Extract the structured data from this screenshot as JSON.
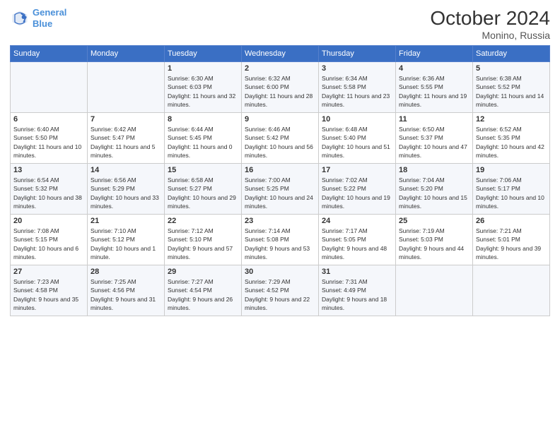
{
  "logo": {
    "line1": "General",
    "line2": "Blue"
  },
  "title": {
    "month": "October 2024",
    "location": "Monino, Russia"
  },
  "weekdays": [
    "Sunday",
    "Monday",
    "Tuesday",
    "Wednesday",
    "Thursday",
    "Friday",
    "Saturday"
  ],
  "weeks": [
    [
      {
        "day": "",
        "sunrise": "",
        "sunset": "",
        "daylight": ""
      },
      {
        "day": "",
        "sunrise": "",
        "sunset": "",
        "daylight": ""
      },
      {
        "day": "1",
        "sunrise": "Sunrise: 6:30 AM",
        "sunset": "Sunset: 6:03 PM",
        "daylight": "Daylight: 11 hours and 32 minutes."
      },
      {
        "day": "2",
        "sunrise": "Sunrise: 6:32 AM",
        "sunset": "Sunset: 6:00 PM",
        "daylight": "Daylight: 11 hours and 28 minutes."
      },
      {
        "day": "3",
        "sunrise": "Sunrise: 6:34 AM",
        "sunset": "Sunset: 5:58 PM",
        "daylight": "Daylight: 11 hours and 23 minutes."
      },
      {
        "day": "4",
        "sunrise": "Sunrise: 6:36 AM",
        "sunset": "Sunset: 5:55 PM",
        "daylight": "Daylight: 11 hours and 19 minutes."
      },
      {
        "day": "5",
        "sunrise": "Sunrise: 6:38 AM",
        "sunset": "Sunset: 5:52 PM",
        "daylight": "Daylight: 11 hours and 14 minutes."
      }
    ],
    [
      {
        "day": "6",
        "sunrise": "Sunrise: 6:40 AM",
        "sunset": "Sunset: 5:50 PM",
        "daylight": "Daylight: 11 hours and 10 minutes."
      },
      {
        "day": "7",
        "sunrise": "Sunrise: 6:42 AM",
        "sunset": "Sunset: 5:47 PM",
        "daylight": "Daylight: 11 hours and 5 minutes."
      },
      {
        "day": "8",
        "sunrise": "Sunrise: 6:44 AM",
        "sunset": "Sunset: 5:45 PM",
        "daylight": "Daylight: 11 hours and 0 minutes."
      },
      {
        "day": "9",
        "sunrise": "Sunrise: 6:46 AM",
        "sunset": "Sunset: 5:42 PM",
        "daylight": "Daylight: 10 hours and 56 minutes."
      },
      {
        "day": "10",
        "sunrise": "Sunrise: 6:48 AM",
        "sunset": "Sunset: 5:40 PM",
        "daylight": "Daylight: 10 hours and 51 minutes."
      },
      {
        "day": "11",
        "sunrise": "Sunrise: 6:50 AM",
        "sunset": "Sunset: 5:37 PM",
        "daylight": "Daylight: 10 hours and 47 minutes."
      },
      {
        "day": "12",
        "sunrise": "Sunrise: 6:52 AM",
        "sunset": "Sunset: 5:35 PM",
        "daylight": "Daylight: 10 hours and 42 minutes."
      }
    ],
    [
      {
        "day": "13",
        "sunrise": "Sunrise: 6:54 AM",
        "sunset": "Sunset: 5:32 PM",
        "daylight": "Daylight: 10 hours and 38 minutes."
      },
      {
        "day": "14",
        "sunrise": "Sunrise: 6:56 AM",
        "sunset": "Sunset: 5:29 PM",
        "daylight": "Daylight: 10 hours and 33 minutes."
      },
      {
        "day": "15",
        "sunrise": "Sunrise: 6:58 AM",
        "sunset": "Sunset: 5:27 PM",
        "daylight": "Daylight: 10 hours and 29 minutes."
      },
      {
        "day": "16",
        "sunrise": "Sunrise: 7:00 AM",
        "sunset": "Sunset: 5:25 PM",
        "daylight": "Daylight: 10 hours and 24 minutes."
      },
      {
        "day": "17",
        "sunrise": "Sunrise: 7:02 AM",
        "sunset": "Sunset: 5:22 PM",
        "daylight": "Daylight: 10 hours and 19 minutes."
      },
      {
        "day": "18",
        "sunrise": "Sunrise: 7:04 AM",
        "sunset": "Sunset: 5:20 PM",
        "daylight": "Daylight: 10 hours and 15 minutes."
      },
      {
        "day": "19",
        "sunrise": "Sunrise: 7:06 AM",
        "sunset": "Sunset: 5:17 PM",
        "daylight": "Daylight: 10 hours and 10 minutes."
      }
    ],
    [
      {
        "day": "20",
        "sunrise": "Sunrise: 7:08 AM",
        "sunset": "Sunset: 5:15 PM",
        "daylight": "Daylight: 10 hours and 6 minutes."
      },
      {
        "day": "21",
        "sunrise": "Sunrise: 7:10 AM",
        "sunset": "Sunset: 5:12 PM",
        "daylight": "Daylight: 10 hours and 1 minute."
      },
      {
        "day": "22",
        "sunrise": "Sunrise: 7:12 AM",
        "sunset": "Sunset: 5:10 PM",
        "daylight": "Daylight: 9 hours and 57 minutes."
      },
      {
        "day": "23",
        "sunrise": "Sunrise: 7:14 AM",
        "sunset": "Sunset: 5:08 PM",
        "daylight": "Daylight: 9 hours and 53 minutes."
      },
      {
        "day": "24",
        "sunrise": "Sunrise: 7:17 AM",
        "sunset": "Sunset: 5:05 PM",
        "daylight": "Daylight: 9 hours and 48 minutes."
      },
      {
        "day": "25",
        "sunrise": "Sunrise: 7:19 AM",
        "sunset": "Sunset: 5:03 PM",
        "daylight": "Daylight: 9 hours and 44 minutes."
      },
      {
        "day": "26",
        "sunrise": "Sunrise: 7:21 AM",
        "sunset": "Sunset: 5:01 PM",
        "daylight": "Daylight: 9 hours and 39 minutes."
      }
    ],
    [
      {
        "day": "27",
        "sunrise": "Sunrise: 7:23 AM",
        "sunset": "Sunset: 4:58 PM",
        "daylight": "Daylight: 9 hours and 35 minutes."
      },
      {
        "day": "28",
        "sunrise": "Sunrise: 7:25 AM",
        "sunset": "Sunset: 4:56 PM",
        "daylight": "Daylight: 9 hours and 31 minutes."
      },
      {
        "day": "29",
        "sunrise": "Sunrise: 7:27 AM",
        "sunset": "Sunset: 4:54 PM",
        "daylight": "Daylight: 9 hours and 26 minutes."
      },
      {
        "day": "30",
        "sunrise": "Sunrise: 7:29 AM",
        "sunset": "Sunset: 4:52 PM",
        "daylight": "Daylight: 9 hours and 22 minutes."
      },
      {
        "day": "31",
        "sunrise": "Sunrise: 7:31 AM",
        "sunset": "Sunset: 4:49 PM",
        "daylight": "Daylight: 9 hours and 18 minutes."
      },
      {
        "day": "",
        "sunrise": "",
        "sunset": "",
        "daylight": ""
      },
      {
        "day": "",
        "sunrise": "",
        "sunset": "",
        "daylight": ""
      }
    ]
  ]
}
